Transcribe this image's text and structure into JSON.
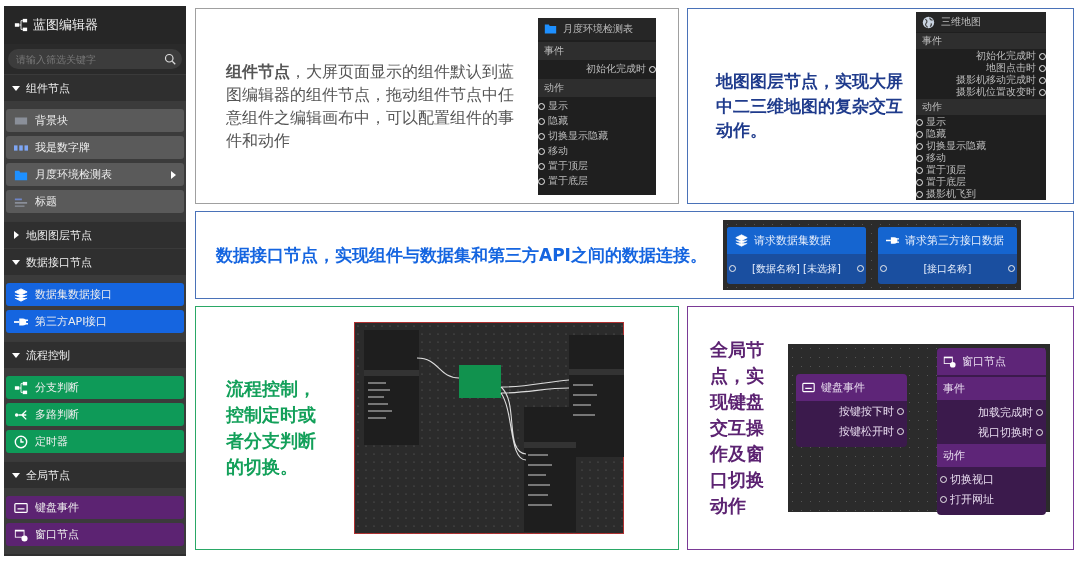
{
  "sidebar": {
    "title": "蓝图编辑器",
    "search": {
      "placeholder": "请输入筛选关键字"
    },
    "groups": [
      {
        "label": "组件节点",
        "expanded": true,
        "items": [
          {
            "label": "背景块",
            "kind": "block",
            "color": "#5a5a5a",
            "submenu": false
          },
          {
            "label": "我是数字牌",
            "kind": "digits",
            "color": "#5a5a5a",
            "submenu": false
          },
          {
            "label": "月度环境检测表",
            "kind": "folder",
            "color": "#5a5a5a",
            "submenu": true
          },
          {
            "label": "标题",
            "kind": "title",
            "color": "#5a5a5a",
            "submenu": false
          }
        ]
      },
      {
        "label": "地图图层节点",
        "expanded": false
      },
      {
        "label": "数据接口节点",
        "expanded": true,
        "items": [
          {
            "label": "数据集数据接口",
            "kind": "layers",
            "color": "#1565e0",
            "submenu": false
          },
          {
            "label": "第三方API接口",
            "kind": "plug",
            "color": "#1565e0",
            "submenu": false
          }
        ]
      },
      {
        "label": "流程控制",
        "expanded": true,
        "items": [
          {
            "label": "分支判断",
            "kind": "branch",
            "color": "#0e9a58",
            "submenu": false
          },
          {
            "label": "多路判断",
            "kind": "multi",
            "color": "#0e9a58",
            "submenu": false
          },
          {
            "label": "定时器",
            "kind": "clock",
            "color": "#0e9a58",
            "submenu": false
          }
        ]
      },
      {
        "label": "全局节点",
        "expanded": true,
        "items": [
          {
            "label": "键盘事件",
            "kind": "keyboard",
            "color": "#5c2372",
            "submenu": false
          },
          {
            "label": "窗口节点",
            "kind": "window",
            "color": "#5c2372",
            "submenu": false
          }
        ]
      }
    ]
  },
  "cards": [
    {
      "kind": "component",
      "color": "#a0a0a0",
      "description": "**组件节点**，大屏页面显示的组件默认到蓝图编辑器的组件节点，拖动组件节点中任意组件之编辑画布中，可以配置组件的事件和动作",
      "nodes": [
        {
          "title": "月度环境检测表",
          "kind": "folder",
          "sections": [
            {
              "label": "事件",
              "kind": "events",
              "ports": [
                "初始化完成时"
              ]
            },
            {
              "label": "动作",
              "kind": "actions",
              "ports": [
                "显示",
                "隐藏",
                "切换显示隐藏",
                "移动",
                "置于顶层",
                "置于底层"
              ]
            }
          ]
        }
      ]
    },
    {
      "kind": "map",
      "color": "#4a72b8",
      "description": "**地图图层节点**，实现大屏中二三维地图的复杂交互动作。",
      "nodes": [
        {
          "title": "三维地图",
          "kind": "globe",
          "sections": [
            {
              "label": "事件",
              "kind": "events",
              "ports": [
                "初始化完成时",
                "地图点击时",
                "摄影机移动完成时",
                "摄影机位置改变时"
              ]
            },
            {
              "label": "动作",
              "kind": "actions",
              "ports": [
                "显示",
                "隐藏",
                "切换显示隐藏",
                "移动",
                "置于顶层",
                "置于底层",
                "摄影机飞到"
              ]
            }
          ]
        }
      ]
    },
    {
      "kind": "data",
      "color": "#4a72b8",
      "description": "**数据接口节点**，实现组件与数据集和第三方API之间的数据连接。",
      "nodes": [
        {
          "title": "请求数据集数据",
          "kind": "layers",
          "param": "[数据名称] [未选择]"
        },
        {
          "title": "请求第三方接口数据",
          "kind": "plug",
          "param": "[接口名称]"
        }
      ]
    },
    {
      "kind": "flow",
      "color": "#2aa866",
      "description": "**流程控制**，控制定时或者分支判断的切换。"
    },
    {
      "kind": "global",
      "color": "#7a3a96",
      "description": "**全局节点**，实现键盘交互操作及窗口切换动作",
      "nodes": [
        {
          "title": "键盘事件",
          "kind": "keyboard",
          "sections": [
            {
              "kind": "events",
              "ports": [
                "按键按下时",
                "按键松开时"
              ]
            }
          ]
        },
        {
          "title": "窗口节点",
          "kind": "window",
          "sections": [
            {
              "label": "事件",
              "kind": "events",
              "ports": [
                "加载完成时",
                "视口切换时"
              ]
            },
            {
              "label": "动作",
              "kind": "actions",
              "ports": [
                "切换视口",
                "打开网址"
              ]
            }
          ]
        }
      ]
    }
  ]
}
